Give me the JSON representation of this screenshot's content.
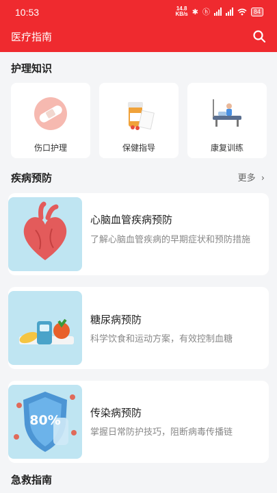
{
  "status": {
    "time": "10:53",
    "netspeed_value": "14.8",
    "netspeed_unit": "KB/s",
    "battery": "84"
  },
  "header": {
    "title": "医疗指南",
    "search_icon": "search-icon"
  },
  "care_section": {
    "title": "护理知识",
    "items": [
      {
        "label": "伤口护理",
        "icon": "bandage-icon"
      },
      {
        "label": "保健指导",
        "icon": "medicine-bottle-icon"
      },
      {
        "label": "康复训练",
        "icon": "rehab-bed-icon"
      }
    ]
  },
  "prevention_section": {
    "title": "疾病预防",
    "more_label": "更多",
    "items": [
      {
        "title": "心脑血管疾病预防",
        "desc": "了解心脑血管疾病的早期症状和预防措施",
        "icon": "heart-icon"
      },
      {
        "title": "糖尿病预防",
        "desc": "科学饮食和运动方案，有效控制血糖",
        "icon": "glucose-meter-icon"
      },
      {
        "title": "传染病预防",
        "desc": "掌握日常防护技巧，阻断病毒传播链",
        "icon": "virus-shield-icon",
        "badge": "80%"
      }
    ]
  },
  "first_aid_section": {
    "title": "急救指南"
  }
}
